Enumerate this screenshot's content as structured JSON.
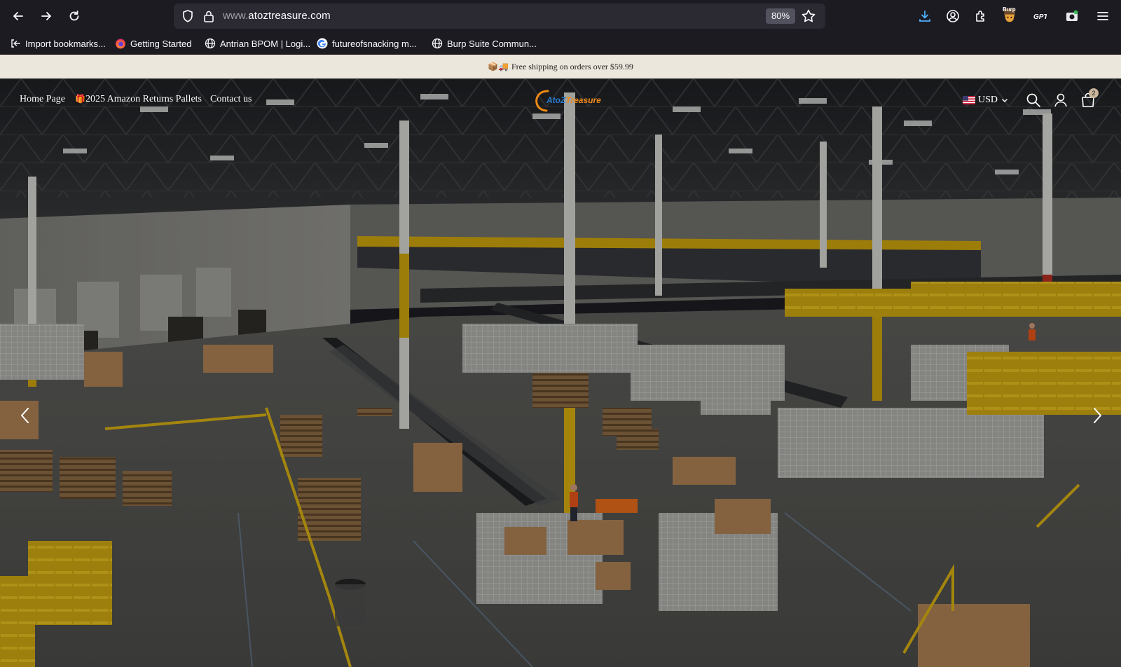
{
  "browser": {
    "url_domain": "www.atoztreasure.com",
    "zoom": "80%",
    "bookmarks": [
      {
        "label": "Import bookmarks...",
        "icon": "import-icon"
      },
      {
        "label": "Getting Started",
        "icon": "firefox-icon"
      },
      {
        "label": "Antrian BPOM | Logi...",
        "icon": "globe-icon"
      },
      {
        "label": "futureofsnacking m...",
        "icon": "google-icon"
      },
      {
        "label": "Burp Suite Commun...",
        "icon": "globe-icon"
      }
    ],
    "extension_label": "Burp"
  },
  "announcement": {
    "emoji": "📦🚚",
    "text": "Free shipping on orders over $59.99"
  },
  "header": {
    "nav": [
      "Home Page",
      "2025 Amazon Returns Pallets",
      "Contact us"
    ],
    "nav_gift_emoji": "🎁",
    "logo_part1": "AtoZ",
    "logo_part2": "Treasure",
    "currency": "USD",
    "cart_count": "2"
  },
  "colors": {
    "chrome_bg": "#1c1b22",
    "urlbar_bg": "#2b2a33",
    "announcement_bg": "#ece7dc",
    "download_blue": "#4fb0ff",
    "logo_blue": "#2a7bd0",
    "logo_orange": "#f08a17"
  }
}
